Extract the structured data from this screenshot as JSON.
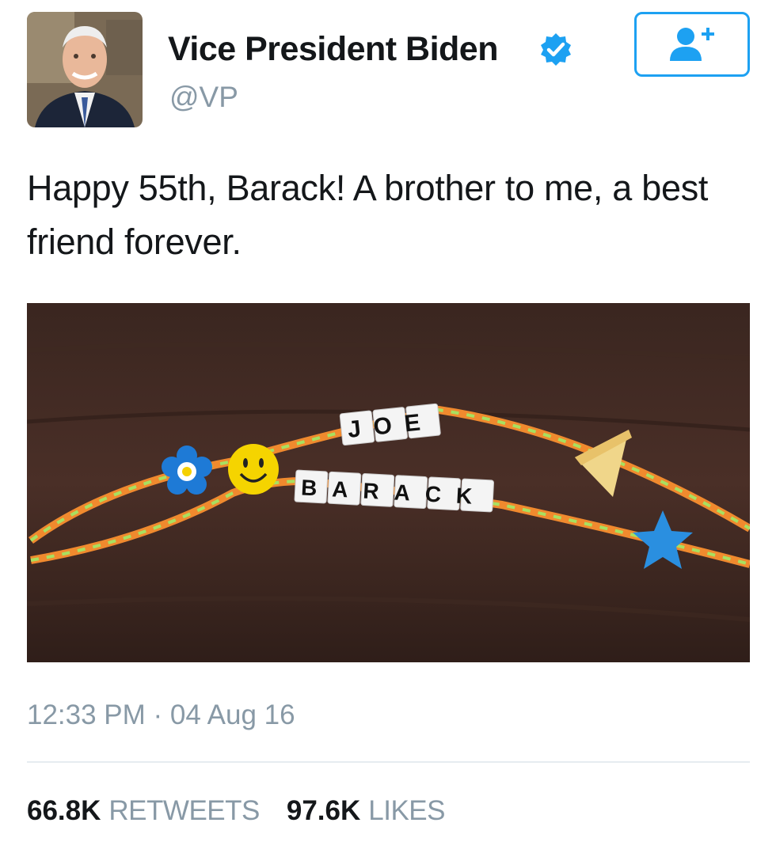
{
  "author": {
    "display_name": "Vice President Biden",
    "handle": "@VP",
    "verified": true
  },
  "follow_button": {
    "icon": "add-user-icon"
  },
  "tweet": {
    "text": "Happy 55th, Barack! A brother to me, a best friend forever.",
    "timestamp": "12:33 PM · 04 Aug 16"
  },
  "media": {
    "beads_top": "JOE",
    "beads_bottom": "BARACK"
  },
  "stats": {
    "retweets_count": "66.8K",
    "retweets_label": "RETWEETS",
    "likes_count": "97.6K",
    "likes_label": "LIKES"
  },
  "colors": {
    "accent": "#1da1f2",
    "muted": "#8899a6",
    "text": "#14171a"
  }
}
